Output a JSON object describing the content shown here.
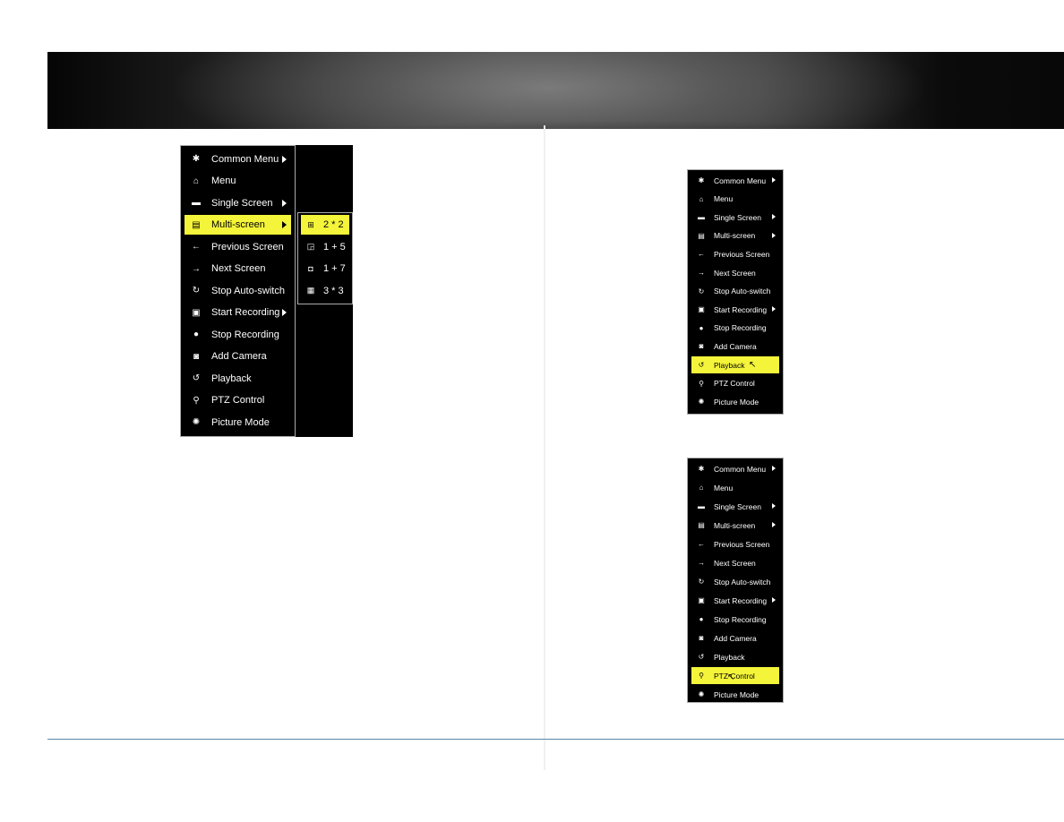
{
  "colors": {
    "highlight": "#f4f43a",
    "menu_bg": "#000000",
    "footer_line": "#5b86a8"
  },
  "menu_items": [
    {
      "label": "Common Menu",
      "icon": "common-menu-icon",
      "glyph": "✱",
      "submenu": true
    },
    {
      "label": "Menu",
      "icon": "home-icon",
      "glyph": "⌂",
      "submenu": false
    },
    {
      "label": "Single Screen",
      "icon": "single-screen-icon",
      "glyph": "▬",
      "submenu": true
    },
    {
      "label": "Multi-screen",
      "icon": "multi-screen-icon",
      "glyph": "▤",
      "submenu": true
    },
    {
      "label": "Previous Screen",
      "icon": "arrow-left-icon",
      "glyph": "←",
      "submenu": false
    },
    {
      "label": "Next Screen",
      "icon": "arrow-right-icon",
      "glyph": "→",
      "submenu": false
    },
    {
      "label": "Stop Auto-switch",
      "icon": "stop-auto-switch-icon",
      "glyph": "↻",
      "submenu": false
    },
    {
      "label": "Start Recording",
      "icon": "start-recording-icon",
      "glyph": "▣",
      "submenu": true
    },
    {
      "label": "Stop Recording",
      "icon": "stop-recording-icon",
      "glyph": "●",
      "submenu": false
    },
    {
      "label": "Add Camera",
      "icon": "add-camera-icon",
      "glyph": "◙",
      "submenu": false
    },
    {
      "label": "Playback",
      "icon": "playback-icon",
      "glyph": "↺",
      "submenu": false
    },
    {
      "label": "PTZ Control",
      "icon": "ptz-control-icon",
      "glyph": "⚲",
      "submenu": false
    },
    {
      "label": "Picture Mode",
      "icon": "picture-mode-icon",
      "glyph": "✺",
      "submenu": false
    }
  ],
  "menu_a": {
    "highlighted": "Multi-screen"
  },
  "multi_screen_submenu": [
    {
      "label": "2 * 2",
      "icon": "grid-2x2-icon",
      "glyph": "⊞"
    },
    {
      "label": "1 + 5",
      "icon": "layout-1plus5-icon",
      "glyph": "◲"
    },
    {
      "label": "1 + 7",
      "icon": "layout-1plus7-icon",
      "glyph": "◘"
    },
    {
      "label": "3 * 3",
      "icon": "grid-3x3-icon",
      "glyph": "▦"
    }
  ],
  "multi_screen_submenu_highlighted": "2 * 2",
  "menu_b": {
    "highlighted": "Playback"
  },
  "menu_c": {
    "highlighted": "PTZ Control"
  },
  "cursor_glyph": "↖"
}
